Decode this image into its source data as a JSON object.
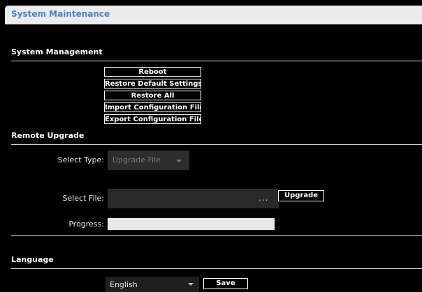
{
  "window": {
    "title": "System Maintenance"
  },
  "system_management": {
    "title": "System Management",
    "buttons": [
      "Reboot",
      "Restore Default Settings",
      "Restore All",
      "Import Configuration File",
      "Export Configuration File"
    ]
  },
  "remote_upgrade": {
    "title": "Remote Upgrade",
    "select_type_label": "Select Type:",
    "select_type_value": "Upgrade File",
    "select_file_label": "Select File:",
    "select_file_value": "",
    "browse_label": "...",
    "upgrade_button": "Upgrade",
    "progress_label": "Progress:",
    "progress_fraction": 0
  },
  "language": {
    "title": "Language",
    "selected": "English",
    "save_button": "Save"
  }
}
